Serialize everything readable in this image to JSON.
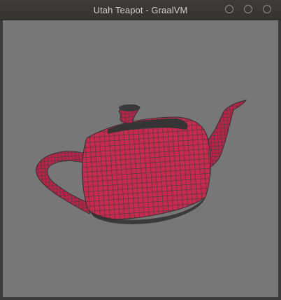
{
  "window": {
    "title": "Utah Teapot - GraalVM",
    "controls": [
      "minimize",
      "maximize",
      "close"
    ]
  },
  "viewport": {
    "background": "#777777",
    "model": "teapot",
    "render_mode": "wireframe",
    "wire_color": "#3e3e3e",
    "face_color": "#c8294f"
  }
}
